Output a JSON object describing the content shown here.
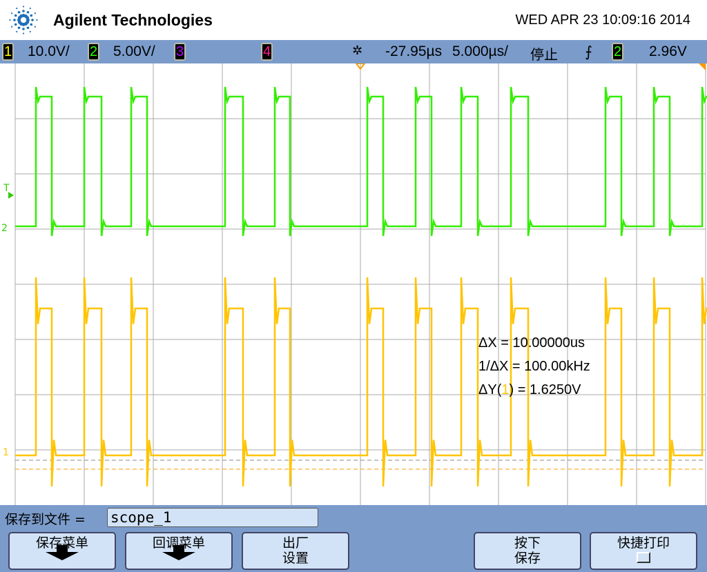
{
  "header": {
    "brand": "Agilent Technologies",
    "datetime": "WED APR 23 10:09:16 2014",
    "logo_icon": "agilent-spark-icon"
  },
  "status": {
    "ch1": {
      "num": "1",
      "scale": "10.0V/",
      "color": "#ffff00"
    },
    "ch2": {
      "num": "2",
      "scale": "5.00V/",
      "color": "#33ff00"
    },
    "ch3": {
      "num": "3",
      "color": "#b000ff"
    },
    "ch4": {
      "num": "4",
      "color": "#ff1a8c"
    },
    "delay": "-27.95µs",
    "timebase": "5.000µs/",
    "run_state": "停止",
    "trigger_icon": "rising-edge-trigger-icon",
    "trigger_source": "2",
    "trigger_level": "2.96V"
  },
  "screen": {
    "trace1_color": "#ffc400",
    "trace2_color": "#33ee00",
    "cursor_color": "#ff9900",
    "ch2_marker": "2",
    "ch1_marker": "1",
    "trigger_marker": "T"
  },
  "measurements": {
    "dx": "ΔX = 10.00000us",
    "inv_dx": "1/ΔX = 100.00kHz",
    "dy_prefix": "ΔY(",
    "dy_ch": "1",
    "dy_suffix": ") = 1.6250V"
  },
  "menu": {
    "file_label": "保存到文件 =",
    "file_value": "scope_1",
    "buttons": [
      {
        "label": "保存菜单"
      },
      {
        "label": "回调菜单"
      },
      {
        "label": "出厂",
        "label2": "设置"
      },
      {
        "label": "按下",
        "label2": "保存"
      },
      {
        "label": "快捷打印"
      }
    ]
  }
}
